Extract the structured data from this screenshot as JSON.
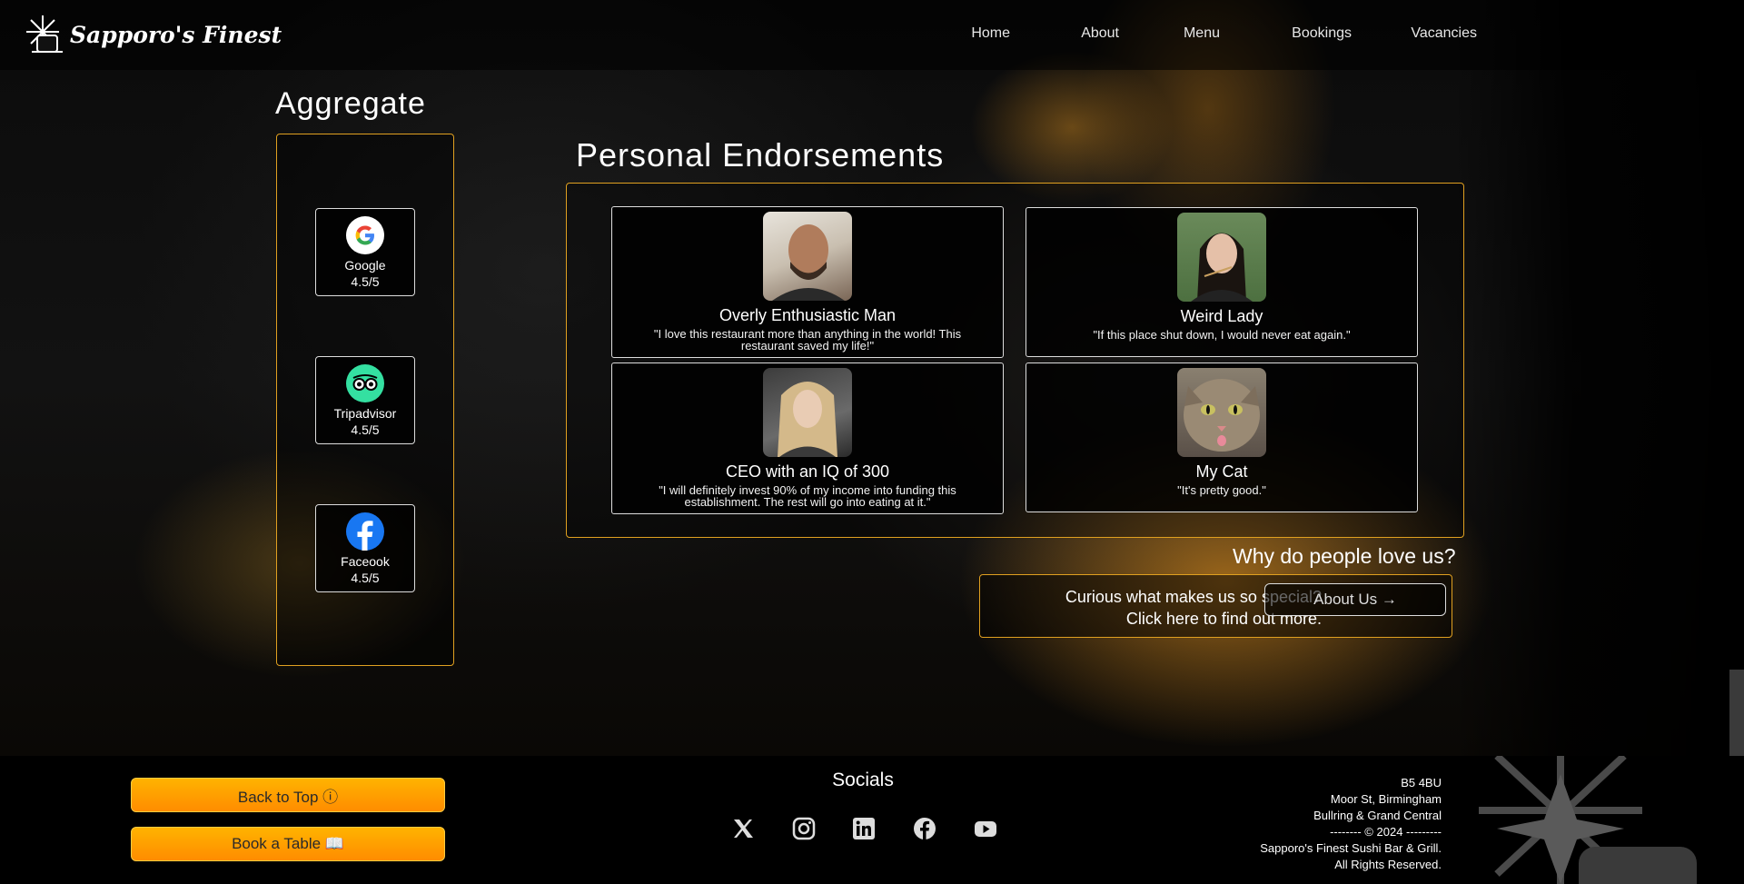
{
  "brand": {
    "name": "Sapporo's Finest"
  },
  "nav": {
    "items": [
      {
        "label": "Home"
      },
      {
        "label": "About"
      },
      {
        "label": "Menu"
      },
      {
        "label": "Bookings"
      },
      {
        "label": "Vacancies"
      }
    ]
  },
  "aggregate": {
    "title": "Aggregate",
    "ratings": [
      {
        "name": "Google",
        "score": "4.5/5",
        "icon": "google-icon"
      },
      {
        "name": "Tripadvisor",
        "score": "4.5/5",
        "icon": "tripadvisor-icon"
      },
      {
        "name": "Faceook",
        "score": "4.5/5",
        "icon": "facebook-icon"
      }
    ]
  },
  "endorsements": {
    "title": "Personal Endorsements",
    "items": [
      {
        "name": "Overly Enthusiastic Man",
        "quote": "\"I love this restaurant more than anything in the world! This restaurant saved my life!\""
      },
      {
        "name": "Weird Lady",
        "quote": "\"If this place shut down, I would never eat again.\""
      },
      {
        "name": "CEO with an IQ of 300",
        "quote": "\"I will definitely invest 90% of my income into funding this establishment. The rest will go into eating at it.\""
      },
      {
        "name": "My Cat",
        "quote": "\"It's pretty good.\""
      }
    ]
  },
  "why": {
    "title": "Why do people love us?",
    "line1": "Curious what makes us so special?",
    "line2": "Click here to find out more.",
    "button_label": "About Us →"
  },
  "footer": {
    "back_to_top": "Back to Top ⓘ",
    "book_table": "Book a Table 📖",
    "socials_title": "Socials",
    "socials": [
      "x-icon",
      "instagram-icon",
      "linkedin-icon",
      "facebook-icon",
      "youtube-icon"
    ],
    "address_lines": [
      "B5 4BU",
      "Moor St, Birmingham",
      "Bullring & Grand Central",
      "-------- © 2024 ---------",
      "Sapporo's Finest Sushi Bar & Grill.",
      "All Rights Reserved."
    ]
  },
  "colors": {
    "accent": "#e0a020",
    "button_orange": "#ff9800"
  }
}
